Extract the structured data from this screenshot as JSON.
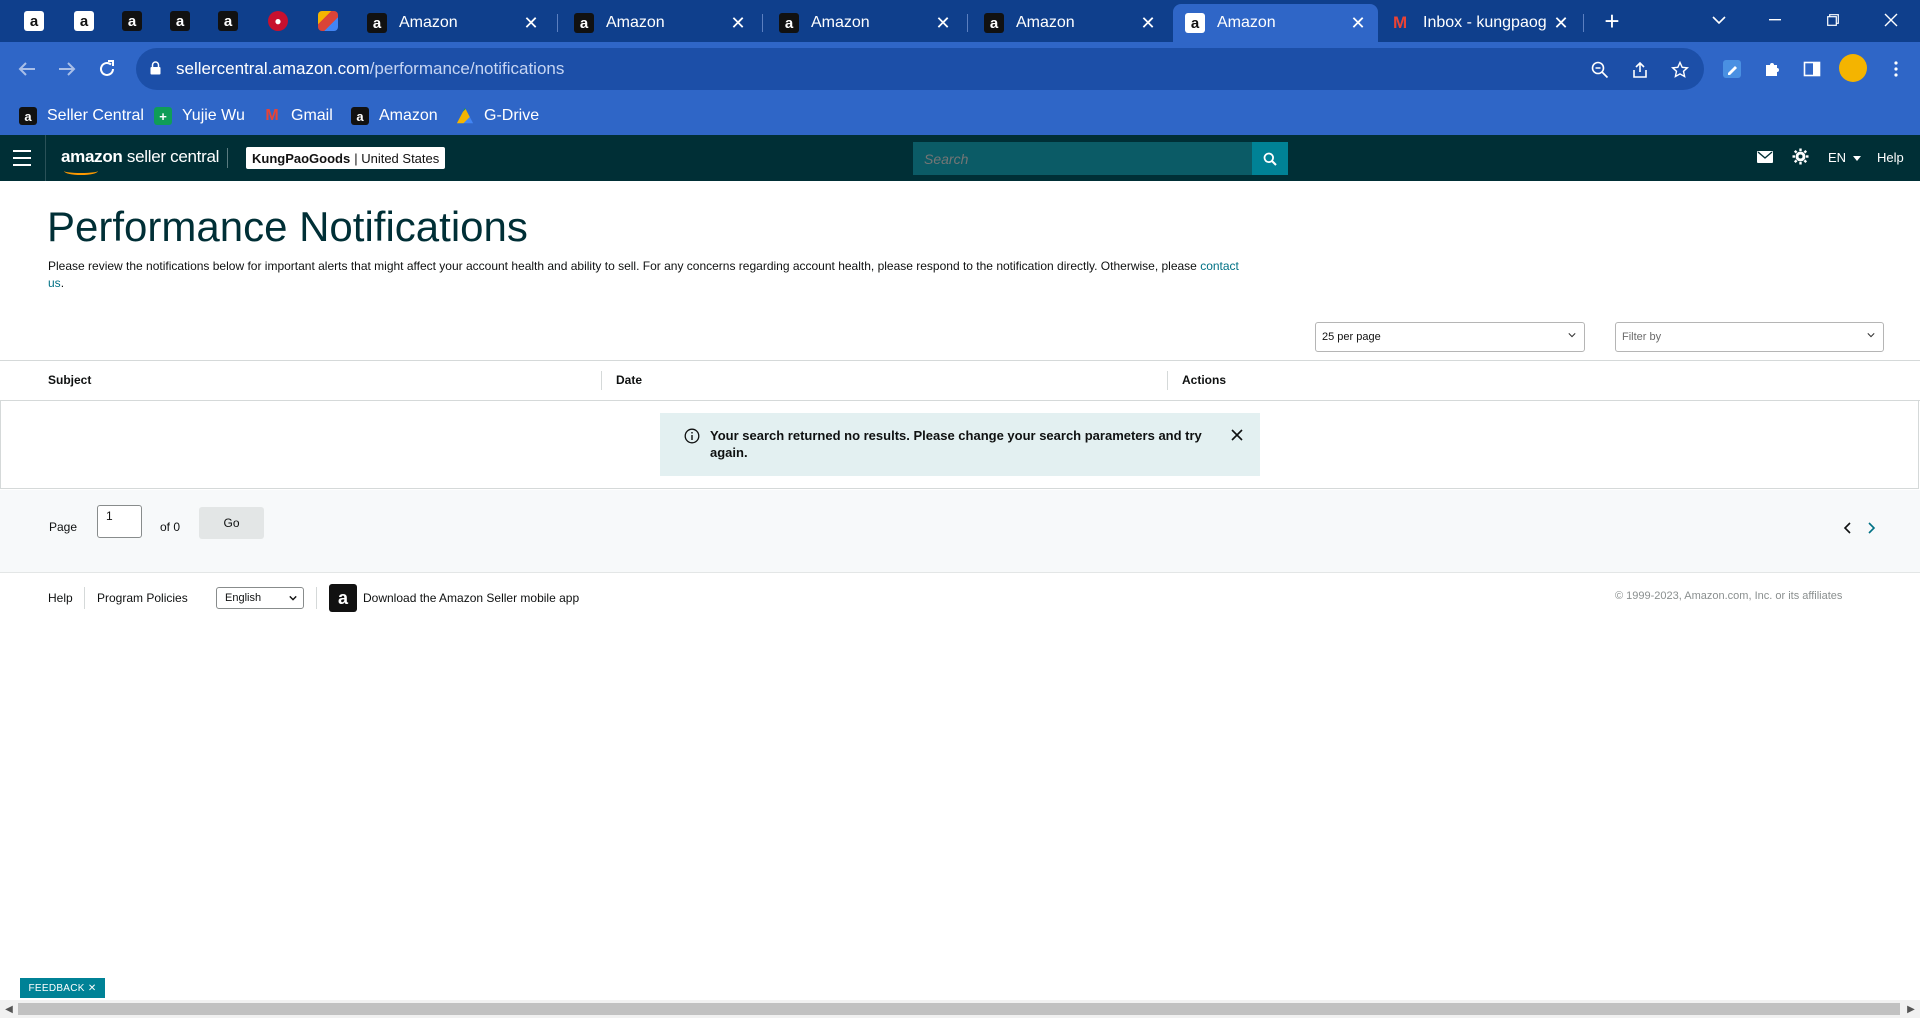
{
  "browser": {
    "tabs": [
      {
        "label": "Amazon",
        "active": false
      },
      {
        "label": "Amazon",
        "active": false
      },
      {
        "label": "Amazon",
        "active": false
      },
      {
        "label": "Amazon",
        "active": false
      },
      {
        "label": "Amazon",
        "active": true
      },
      {
        "label": "Inbox - kungpaog",
        "active": false
      }
    ],
    "url_domain": "sellercentral.amazon.com",
    "url_path": "/performance/notifications",
    "bookmarks": [
      "Seller Central",
      "Yujie Wu",
      "Gmail",
      "Amazon",
      "G-Drive"
    ]
  },
  "header": {
    "logo_brand": "amazon",
    "logo_product": " seller central",
    "store_name": "KungPaoGoods",
    "store_marketplace": "| United States",
    "search_placeholder": "Search",
    "language": "EN",
    "help": "Help"
  },
  "page": {
    "title": "Performance Notifications",
    "intro": "Please review the notifications below for important alerts that might affect your account health and ability to sell. For any concerns regarding account health, please respond to the notification directly. Otherwise, please ",
    "contact_link": "contact us",
    "intro_end": ".",
    "per_page": "25 per page",
    "filter_placeholder": "Filter by"
  },
  "table": {
    "columns": [
      "Subject",
      "Date",
      "Actions"
    ],
    "empty_message": "Your search returned no results. Please change your search parameters and try again."
  },
  "pagination": {
    "page_label": "Page",
    "page_value": "1",
    "of_label": "of 0",
    "go_label": "Go"
  },
  "footer": {
    "help": "Help",
    "program_policies": "Program Policies",
    "language": "English",
    "app_link": "Download the Amazon Seller mobile app",
    "copyright": "© 1999-2023, Amazon.com, Inc. or its affiliates"
  },
  "feedback_label": "FEEDBACK ✕",
  "colors": {
    "header_bg": "#002f36",
    "accent_teal": "#008296",
    "title_color": "#002f36",
    "link_color": "#007185",
    "browser_blue": "#2f66c7"
  }
}
